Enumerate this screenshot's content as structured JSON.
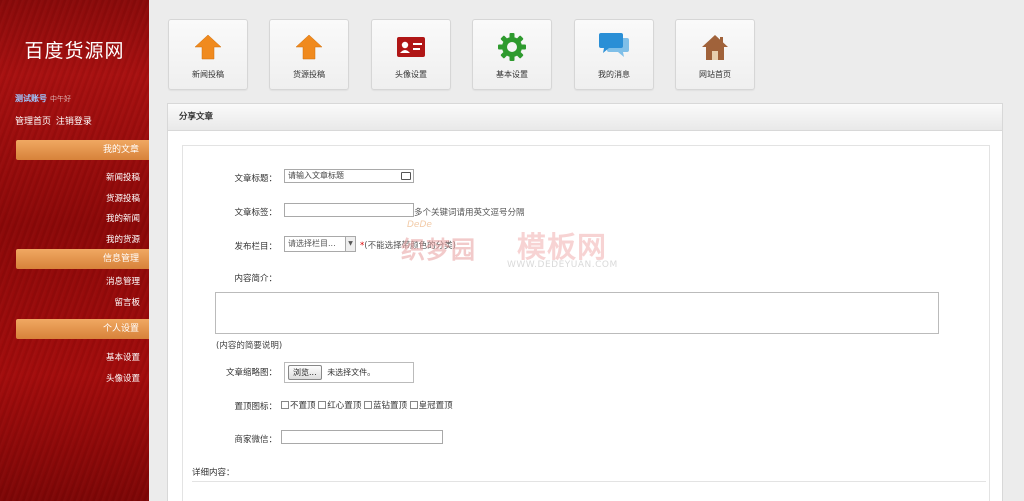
{
  "sidebar": {
    "site_title": "百度货源网",
    "user_name": "测试账号",
    "greeting": "中午好",
    "link_admin": "管理首页",
    "link_logout": "注销登录",
    "sections": [
      {
        "title": "我的文章",
        "items": [
          "新闻投稿",
          "货源投稿",
          "我的新闻",
          "我的货源"
        ]
      },
      {
        "title": "信息管理",
        "items": [
          "消息管理",
          "留言板"
        ]
      },
      {
        "title": "个人设置",
        "items": [
          "基本设置",
          "头像设置"
        ]
      }
    ]
  },
  "shortcuts": [
    {
      "label": "新闻投稿",
      "icon": "upload-arrow-icon"
    },
    {
      "label": "货源投稿",
      "icon": "upload-arrow-icon"
    },
    {
      "label": "头像设置",
      "icon": "id-card-icon"
    },
    {
      "label": "基本设置",
      "icon": "gear-icon"
    },
    {
      "label": "我的消息",
      "icon": "chat-bubbles-icon"
    },
    {
      "label": "网站首页",
      "icon": "home-icon"
    }
  ],
  "panel": {
    "title": "分享文章",
    "form": {
      "title_label": "文章标题：",
      "title_placeholder": "请输入文章标题",
      "tags_label": "文章标签：",
      "tags_hint": "多个关键词请用英文逗号分隔",
      "column_label": "发布栏目：",
      "column_value": "请选择栏目...",
      "column_hint": "(不能选择带颜色的分类)",
      "summary_label": "内容简介：",
      "summary_hint": "(内容的简要说明)",
      "thumb_label": "文章缩略图：",
      "browse_button": "浏览...",
      "no_file": "未选择文件。",
      "top_label": "置顶图标：",
      "top_options": [
        "不置顶",
        "红心置顶",
        "蓝钻置顶",
        "皇冠置顶"
      ],
      "wechat_label": "商家微信：",
      "detail_label": "详细内容："
    }
  },
  "watermark": {
    "small_brand": "DeDe",
    "brand_cn": "织梦园",
    "brand_cn2": "模板网",
    "url": "WWW.DEDEYUAN.COM"
  },
  "colors": {
    "sidebar_red": "#a81010",
    "menu_orange": "#e39248",
    "upload_orange": "#f08a1e",
    "gear_green": "#2e9a2e",
    "chat_blue": "#2a8fd6",
    "home_brown": "#a0623a",
    "card_red": "#b01616"
  }
}
